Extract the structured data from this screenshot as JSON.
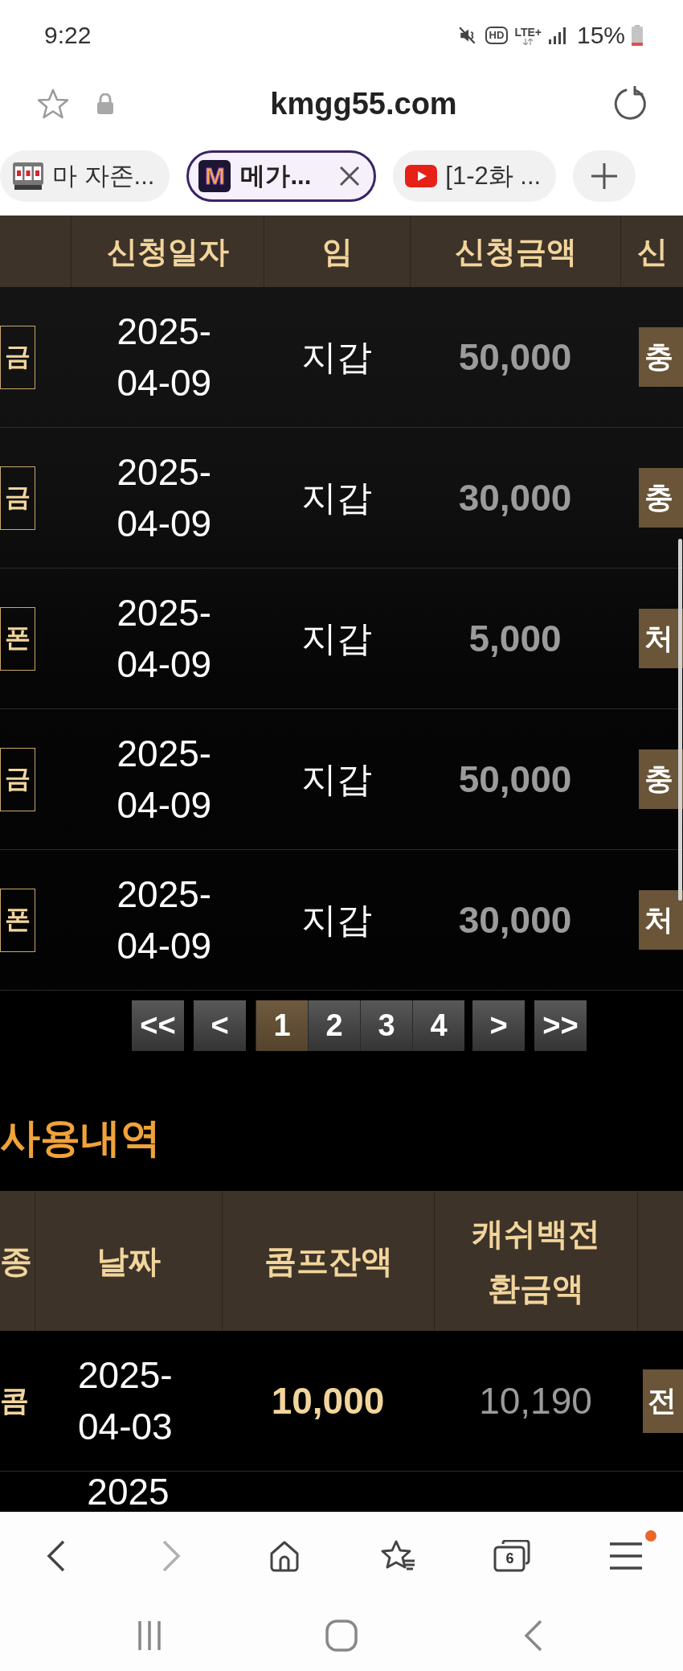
{
  "status_bar": {
    "time": "9:22",
    "hd": "HD",
    "network": "LTE+",
    "battery": "15%"
  },
  "address_bar": {
    "url": "kmgg55.com"
  },
  "browser_tabs": [
    {
      "kind": "slot",
      "title": "마 자존...",
      "selected": false
    },
    {
      "kind": "logo",
      "logo": "M",
      "title": "메가...",
      "selected": true
    },
    {
      "kind": "video",
      "title": "[1-2화 ...",
      "selected": false
    }
  ],
  "request_table": {
    "columns": [
      "신청일자",
      "임",
      "신청금액",
      "신"
    ],
    "rows": [
      {
        "type": "금",
        "date": "2025-04-09",
        "game": "지갑",
        "amount": "50,000",
        "status": "충"
      },
      {
        "type": "금",
        "date": "2025-04-09",
        "game": "지갑",
        "amount": "30,000",
        "status": "충"
      },
      {
        "type": "폰",
        "date": "2025-04-09",
        "game": "지갑",
        "amount": "5,000",
        "status": "처"
      },
      {
        "type": "금",
        "date": "2025-04-09",
        "game": "지갑",
        "amount": "50,000",
        "status": "충"
      },
      {
        "type": "폰",
        "date": "2025-04-09",
        "game": "지갑",
        "amount": "30,000",
        "status": "처"
      }
    ]
  },
  "pagination": {
    "first": "<<",
    "prev": "<",
    "pages": [
      {
        "label": "1",
        "selected": true
      },
      {
        "label": "2",
        "selected": false
      },
      {
        "label": "3",
        "selected": false
      },
      {
        "label": "4",
        "selected": false
      }
    ],
    "next": ">",
    "last": ">>"
  },
  "usage_section": {
    "title": "사용내역",
    "columns": [
      "종",
      "날짜",
      "콤프잔액",
      "캐쉬백전환금액"
    ],
    "rows": [
      {
        "type": "콤",
        "date": "2025-04-03",
        "comp_balance": "10,000",
        "cashback": "10,190",
        "action": "전"
      },
      {
        "date": "2025"
      }
    ]
  },
  "bottom_toolbar": {
    "back": {
      "disabled": false
    },
    "forward": {
      "disabled": true
    },
    "tab_count": "6",
    "menu_notification": true
  }
}
